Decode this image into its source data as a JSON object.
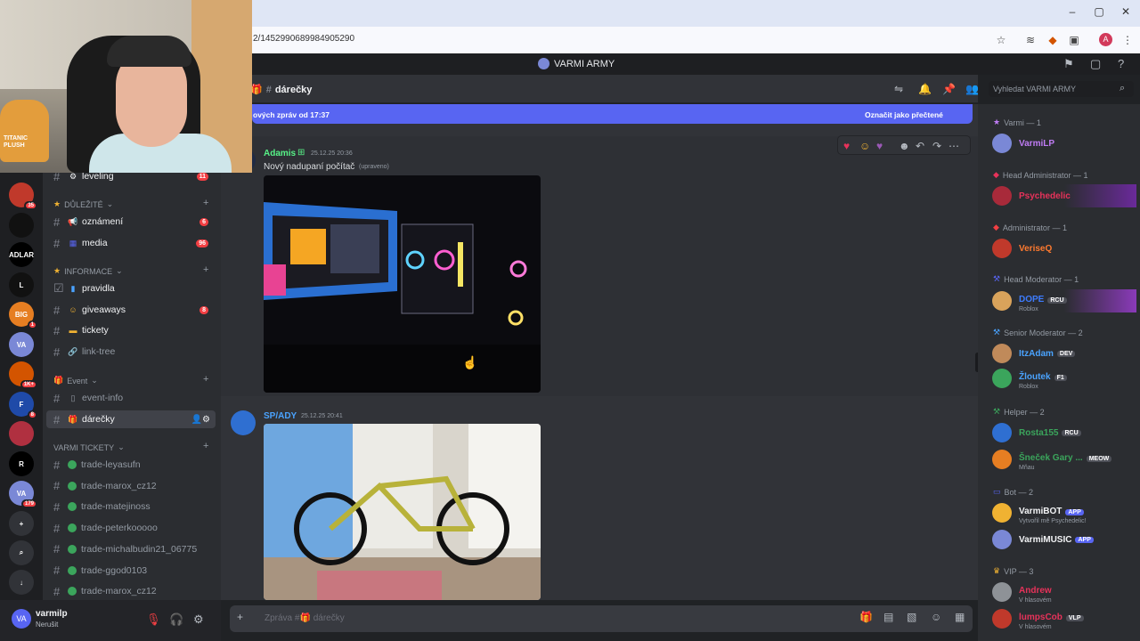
{
  "browser": {
    "url": "2/1452990689984905290",
    "window_controls": [
      "–",
      "▢",
      "✕"
    ],
    "profile_initial": "A"
  },
  "app": {
    "server_name": "VARMI ARMY"
  },
  "webcam": {
    "toy_label": "TITANIC PLUSH"
  },
  "servers": [
    {
      "label": "",
      "badge": "35",
      "color": "#c0392b"
    },
    {
      "label": "",
      "badge": "",
      "color": "#111111"
    },
    {
      "label": "ADLAR",
      "badge": "",
      "color": "#000000"
    },
    {
      "label": "L",
      "badge": "",
      "color": "#111111"
    },
    {
      "label": "BIG",
      "badge": "1",
      "color": "#e67e22"
    },
    {
      "label": "VA",
      "badge": "",
      "color": "#7a88d6"
    },
    {
      "label": "",
      "badge": "1K+",
      "color": "#d35400"
    },
    {
      "label": "F",
      "badge": "8",
      "color": "#1f4aa8"
    },
    {
      "label": "",
      "badge": "",
      "color": "#b03040"
    },
    {
      "label": "R",
      "badge": "",
      "color": "#000000"
    },
    {
      "label": "VA",
      "badge": "179",
      "color": "#7a88d6"
    },
    {
      "label": "+",
      "badge": "",
      "color": "#313338"
    },
    {
      "label": "⌕",
      "badge": "",
      "color": "#313338"
    },
    {
      "label": "↓",
      "badge": "",
      "color": "#313338"
    }
  ],
  "channels": {
    "top": {
      "name": "leveling",
      "badge": "11"
    },
    "cat1": "DŮLEŽITÉ",
    "ch_oznameni": {
      "name": "oznámení",
      "badge": "6"
    },
    "ch_media": {
      "name": "media",
      "badge": "96"
    },
    "cat2": "INFORMACE",
    "ch_pravidla": {
      "name": "pravidla"
    },
    "ch_giveaways": {
      "name": "giveaways",
      "badge": "8"
    },
    "ch_tickety": {
      "name": "tickety"
    },
    "ch_linktree": {
      "name": "link-tree"
    },
    "cat3": "Event",
    "ch_eventinfo": {
      "name": "event-info"
    },
    "ch_darecky": {
      "name": "dárečky"
    },
    "cat4": "VARMI TICKETY",
    "tickets": [
      "trade-leyasufn",
      "trade-marox_cz12",
      "trade-matejinoss",
      "trade-peterkooooo",
      "trade-michalbudin21_06775",
      "trade-ggod0103",
      "trade-marox_cz12"
    ]
  },
  "user": {
    "name": "varmilp",
    "status": "Nerušit"
  },
  "chat": {
    "channel": "dárečky",
    "new_messages": "ových zpráv od 17:37",
    "mark_read": "Označit jako přečtené",
    "msg1": {
      "author": "Adamis",
      "time": "25.12.25 20:36",
      "text": "Nový nadupaní počítač",
      "edited": "(upraveno)",
      "author_color": "#57f287"
    },
    "msg2": {
      "author": "SP/ADY",
      "time": "25.12.25 20:41",
      "author_color": "#4aa3ff"
    },
    "input_placeholder": "Zpráva #🎁 dárečky"
  },
  "search": {
    "placeholder": "Vyhledat VARMI ARMY"
  },
  "members": {
    "r1": "Varmi — 1",
    "m1": {
      "name": "VarmiLP",
      "color": "#c07cf5"
    },
    "r2": "Head Administrator — 1",
    "m2": {
      "name": "Psychedelic",
      "color": "#e8325a"
    },
    "r3": "Administrator — 1",
    "m3": {
      "name": "VeriseQ",
      "color": "#ff7a2f"
    },
    "r4": "Head Moderator — 1",
    "m4": {
      "name": "DOPE",
      "tag": "RCU",
      "sub": "Roblox",
      "color": "#3d7cff"
    },
    "r5": "Senior Moderator — 2",
    "m5": {
      "name": "ItzAdam",
      "tag": "DEV",
      "color": "#4aa3ff"
    },
    "m6": {
      "name": "Žloutek",
      "tag": "F1",
      "sub": "Roblox",
      "color": "#4aa3ff"
    },
    "r6": "Helper — 2",
    "m7": {
      "name": "Rosta155",
      "tag": "RCU",
      "color": "#3ba55c"
    },
    "m8": {
      "name": "Šneček Gary ...",
      "tag": "MEOW",
      "sub": "Mňau",
      "color": "#3ba55c"
    },
    "r7": "Bot — 2",
    "m9": {
      "name": "VarmiBOT",
      "tag": "APP",
      "sub": "Vytvořil mě Psychedelic!",
      "color": "#f2f3f5"
    },
    "m10": {
      "name": "VarmiMUSIC",
      "tag": "APP",
      "color": "#f2f3f5"
    },
    "r8": "VIP — 3",
    "m11": {
      "name": "Andrew",
      "sub": "V hlasovém",
      "color": "#e8325a"
    },
    "m12": {
      "name": "lumpsCob",
      "tag": "VLP",
      "sub": "V hlasovém",
      "color": "#e8325a"
    }
  }
}
